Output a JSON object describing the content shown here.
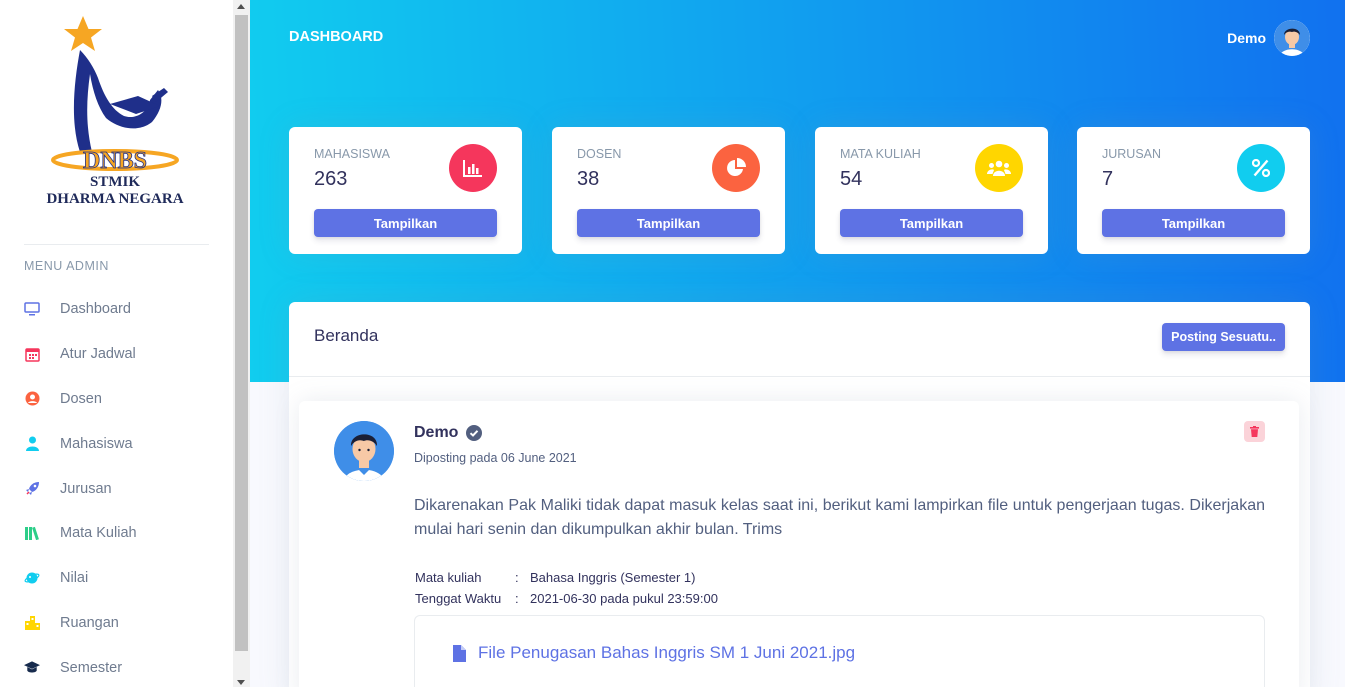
{
  "sidebar": {
    "brand": {
      "line1": "STMIK",
      "line2": "DHARMA NEGARA",
      "logo_text": "DNBS"
    },
    "menu_heading": "MENU ADMIN",
    "items": [
      {
        "label": "Dashboard",
        "icon": "monitor-icon",
        "color": "#5e72e4"
      },
      {
        "label": "Atur Jadwal",
        "icon": "calendar-icon",
        "color": "#f5365c"
      },
      {
        "label": "Dosen",
        "icon": "user-circle-icon",
        "color": "#fb6340"
      },
      {
        "label": "Mahasiswa",
        "icon": "user-icon",
        "color": "#11cdef"
      },
      {
        "label": "Jurusan",
        "icon": "rocket-icon",
        "color": "#5e72e4"
      },
      {
        "label": "Mata Kuliah",
        "icon": "books-icon",
        "color": "#2dce89"
      },
      {
        "label": "Nilai",
        "icon": "planet-icon",
        "color": "#11cdef"
      },
      {
        "label": "Ruangan",
        "icon": "building-icon",
        "color": "#ffd600"
      },
      {
        "label": "Semester",
        "icon": "graduation-cap-icon",
        "color": "#172b4d"
      }
    ]
  },
  "header": {
    "title": "DASHBOARD",
    "user_name": "Demo"
  },
  "stats": [
    {
      "label": "MAHASISWA",
      "value": "263",
      "icon": "bar-chart-icon",
      "color": "#f5365c",
      "button": "Tampilkan"
    },
    {
      "label": "DOSEN",
      "value": "38",
      "icon": "pie-chart-icon",
      "color": "#fb6340",
      "button": "Tampilkan"
    },
    {
      "label": "MATA KULIAH",
      "value": "54",
      "icon": "users-icon",
      "color": "#ffd600",
      "button": "Tampilkan"
    },
    {
      "label": "JURUSAN",
      "value": "7",
      "icon": "percent-icon",
      "color": "#11cdef",
      "button": "Tampilkan"
    }
  ],
  "panel": {
    "title": "Beranda",
    "post_button": "Posting Sesuatu..",
    "post": {
      "author": "Demo",
      "date": "Diposting pada 06 June 2021",
      "body": "Dikarenakan Pak Maliki tidak dapat masuk kelas saat ini, berikut kami lampirkan file untuk pengerjaan tugas. Dikerjakan mulai hari senin dan dikumpulkan akhir bulan. Trims",
      "meta": [
        {
          "key": "Mata kuliah",
          "sep": ":",
          "value": "Bahasa Inggris (Semester 1)"
        },
        {
          "key": "Tenggat Waktu",
          "sep": ":",
          "value": "2021-06-30 pada pukul 23:59:00"
        }
      ],
      "attachment": "File Penugasan Bahas Inggris SM 1 Juni 2021.jpg"
    }
  }
}
